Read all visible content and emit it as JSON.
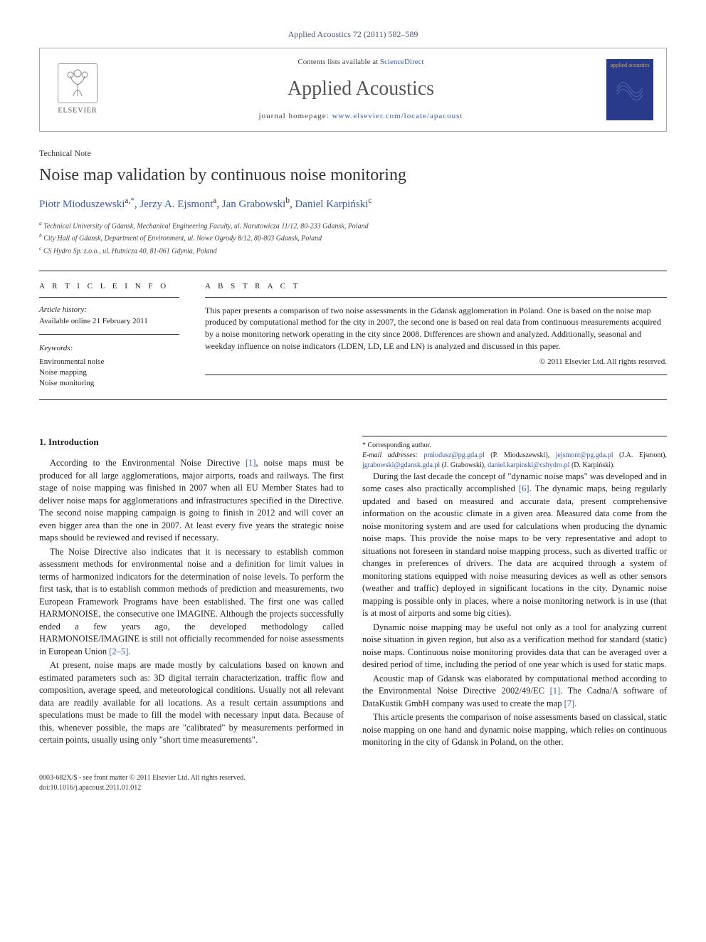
{
  "journal_ref_text": "Applied Acoustics 72 (2011) 582–589",
  "header": {
    "contents_prefix": "Contents lists available at ",
    "contents_link": "ScienceDirect",
    "journal_name": "Applied Acoustics",
    "homepage_prefix": "journal homepage: ",
    "homepage_link": "www.elsevier.com/locate/apacoust",
    "publisher": "ELSEVIER",
    "cover_text": "applied acoustics"
  },
  "article": {
    "type": "Technical Note",
    "title": "Noise map validation by continuous noise monitoring",
    "authors_html_parts": {
      "a1_name": "Piotr Mioduszewski",
      "a1_aff": "a,",
      "a1_corr": "*",
      "sep1": ", ",
      "a2_name": "Jerzy A. Ejsmont",
      "a2_aff": "a",
      "sep2": ", ",
      "a3_name": "Jan Grabowski",
      "a3_aff": "b",
      "sep3": ", ",
      "a4_name": "Daniel Karpiński",
      "a4_aff": "c"
    },
    "affiliations": {
      "a": "Technical University of Gdansk, Mechanical Engineering Faculty, ul. Narutowicza 11/12, 80-233 Gdansk, Poland",
      "b": "City Hall of Gdansk, Department of Environment, ul. Nowe Ogrody 8/12, 80-803 Gdansk, Poland",
      "c": "CS Hydro Sp. z.o.o., ul. Hutnicza 40, 81-061 Gdynia, Poland"
    }
  },
  "article_info": {
    "heading": "A R T I C L E   I N F O",
    "history_heading": "Article history:",
    "available_online": "Available online 21 February 2011",
    "keywords_heading": "Keywords:",
    "keywords": [
      "Environmental noise",
      "Noise mapping",
      "Noise monitoring"
    ]
  },
  "abstract": {
    "heading": "A B S T R A C T",
    "text": "This paper presents a comparison of two noise assessments in the Gdansk agglomeration in Poland. One is based on the noise map produced by computational method for the city in 2007, the second one is based on real data from continuous measurements acquired by a noise monitoring network operating in the city since 2008. Differences are shown and analyzed. Additionally, seasonal and weekday influence on noise indicators (LDEN, LD, LE and LN) is analyzed and discussed in this paper.",
    "copyright": "© 2011 Elsevier Ltd. All rights reserved."
  },
  "body": {
    "section_heading": "1. Introduction",
    "p1a": "According to the Environmental Noise Directive ",
    "ref1": "[1]",
    "p1b": ", noise maps must be produced for all large agglomerations, major airports, roads and railways. The first stage of noise mapping was finished in 2007 when all EU Member States had to deliver noise maps for agglomerations and infrastructures specified in the Directive. The second noise mapping campaign is going to finish in 2012 and will cover an even bigger area than the one in 2007. At least every five years the strategic noise maps should be reviewed and revised if necessary.",
    "p2a": "The Noise Directive also indicates that it is necessary to establish common assessment methods for environmental noise and a definition for limit values in terms of harmonized indicators for the determination of noise levels. To perform the first task, that is to establish common methods of prediction and measurements, two European Framework Programs have been established. The first one was called HARMONOISE, the consecutive one IMAGINE. Although the projects successfully ended a few years ago, the developed methodology called HARMONOISE/IMAGINE is still not officially recommended for noise assessments in European Union ",
    "ref25": "[2–5]",
    "p2b": ".",
    "p3": "At present, noise maps are made mostly by calculations based on known and estimated parameters such as: 3D digital terrain characterization, traffic flow and composition, average speed, and meteorological conditions. Usually not all relevant data are readily available for all locations. As a result certain assumptions and speculations must be made to fill the model with necessary input data. Because of this, whenever possible, the maps are \"calibrated\" by measurements performed in certain points, usually using only \"short time measurements\".",
    "p4a": "During the last decade the concept of \"dynamic noise maps\" was developed and in some cases also practically accomplished ",
    "ref6": "[6]",
    "p4b": ". The dynamic maps, being regularly updated and based on measured and accurate data, present comprehensive information on the acoustic climate in a given area. Measured data come from the noise monitoring system and are used for calculations when producing the dynamic noise maps. This provide the noise maps to be very representative and adopt to situations not foreseen in standard noise mapping process, such as diverted traffic or changes in preferences of drivers. The data are acquired through a system of monitoring stations equipped with noise measuring devices as well as other sensors (weather and traffic) deployed in significant locations in the city. Dynamic noise mapping is possible only in places, where a noise monitoring network is in use (that is at most of airports and some big cities).",
    "p5": "Dynamic noise mapping may be useful not only as a tool for analyzing current noise situation in given region, but also as a verification method for standard (static) noise maps. Continuous noise monitoring provides data that can be averaged over a desired period of time, including the period of one year which is used for static maps.",
    "p6a": "Acoustic map of Gdansk was elaborated by computational method according to the Environmental Noise Directive 2002/49/EC ",
    "ref1b": "[1]",
    "p6b": ". The Cadna/A software of DataKustik GmbH company was used to create the map ",
    "ref7": "[7]",
    "p6c": ".",
    "p7": "This article presents the comparison of noise assessments based on classical, static noise mapping on one hand and dynamic noise mapping, which relies on continuous monitoring in the city of Gdansk in Poland, on the other."
  },
  "footnotes": {
    "corr_label": "* Corresponding author.",
    "email_label": "E-mail addresses: ",
    "e1": "pmiodusz@pg.gda.pl",
    "e1_who": " (P. Mioduszewski), ",
    "e2": "jejsmont@pg.gda.pl",
    "e2_who": " (J.A. Ejsmont), ",
    "e3": "jgrabowski@gdansk.gda.pl",
    "e3_who": " (J. Grabowski), ",
    "e4": "daniel.karpinski@cshydro.pl",
    "e4_who": " (D. Karpiński)."
  },
  "doi": {
    "line1": "0003-682X/$ - see front matter © 2011 Elsevier Ltd. All rights reserved.",
    "line2": "doi:10.1016/j.apacoust.2011.01.012"
  }
}
